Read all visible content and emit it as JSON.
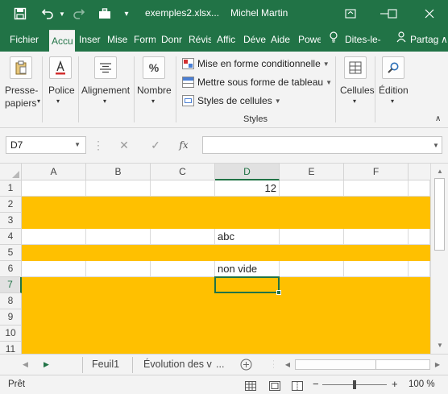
{
  "titlebar": {
    "filename": "exemples2.xlsx...",
    "user": "Michel Martin"
  },
  "tabs": [
    {
      "label": "Fichier"
    },
    {
      "label": "Accu"
    },
    {
      "label": "Inser"
    },
    {
      "label": "Mise"
    },
    {
      "label": "Form"
    },
    {
      "label": "Donr"
    },
    {
      "label": "Révis"
    },
    {
      "label": "Affic"
    },
    {
      "label": "Déve"
    },
    {
      "label": "Aide"
    },
    {
      "label": "Powe"
    }
  ],
  "tell_me": "Dites-le-",
  "share": "Partag",
  "ribbon": {
    "clipboard_line1": "Presse-",
    "clipboard_line2": "papiers",
    "font": "Police",
    "alignment": "Alignement",
    "number": "Nombre",
    "number_icon": "%",
    "conditional_format": "Mise en forme conditionnelle",
    "format_as_table": "Mettre sous forme de tableau",
    "cell_styles": "Styles de cellules",
    "styles_group": "Styles",
    "cells": "Cellules",
    "editing": "Édition"
  },
  "formula_bar": {
    "name_box": "D7",
    "fx": "fx",
    "value": ""
  },
  "columns": [
    "A",
    "B",
    "C",
    "D",
    "E",
    "F"
  ],
  "selected_column": "D",
  "rows": [
    {
      "num": "1",
      "highlight": false,
      "D": "12"
    },
    {
      "num": "2",
      "highlight": true,
      "D": ""
    },
    {
      "num": "3",
      "highlight": true,
      "D": ""
    },
    {
      "num": "4",
      "highlight": false,
      "D": "abc"
    },
    {
      "num": "5",
      "highlight": true,
      "D": ""
    },
    {
      "num": "6",
      "highlight": false,
      "D": "non vide"
    },
    {
      "num": "7",
      "highlight": true,
      "D": ""
    },
    {
      "num": "8",
      "highlight": true,
      "D": ""
    },
    {
      "num": "9",
      "highlight": true,
      "D": ""
    },
    {
      "num": "10",
      "highlight": true,
      "D": ""
    },
    {
      "num": "11",
      "highlight": true,
      "D": ""
    }
  ],
  "selected_row": "7",
  "highlight_color": "#ffc000",
  "accent_color": "#217346",
  "sheets": [
    {
      "label": "Feuil1"
    },
    {
      "label": "Évolution des v"
    }
  ],
  "sheet_more": "...",
  "status": {
    "ready": "Prêt",
    "zoom": "100 %",
    "zoom_minus": "−",
    "zoom_plus": "+"
  }
}
